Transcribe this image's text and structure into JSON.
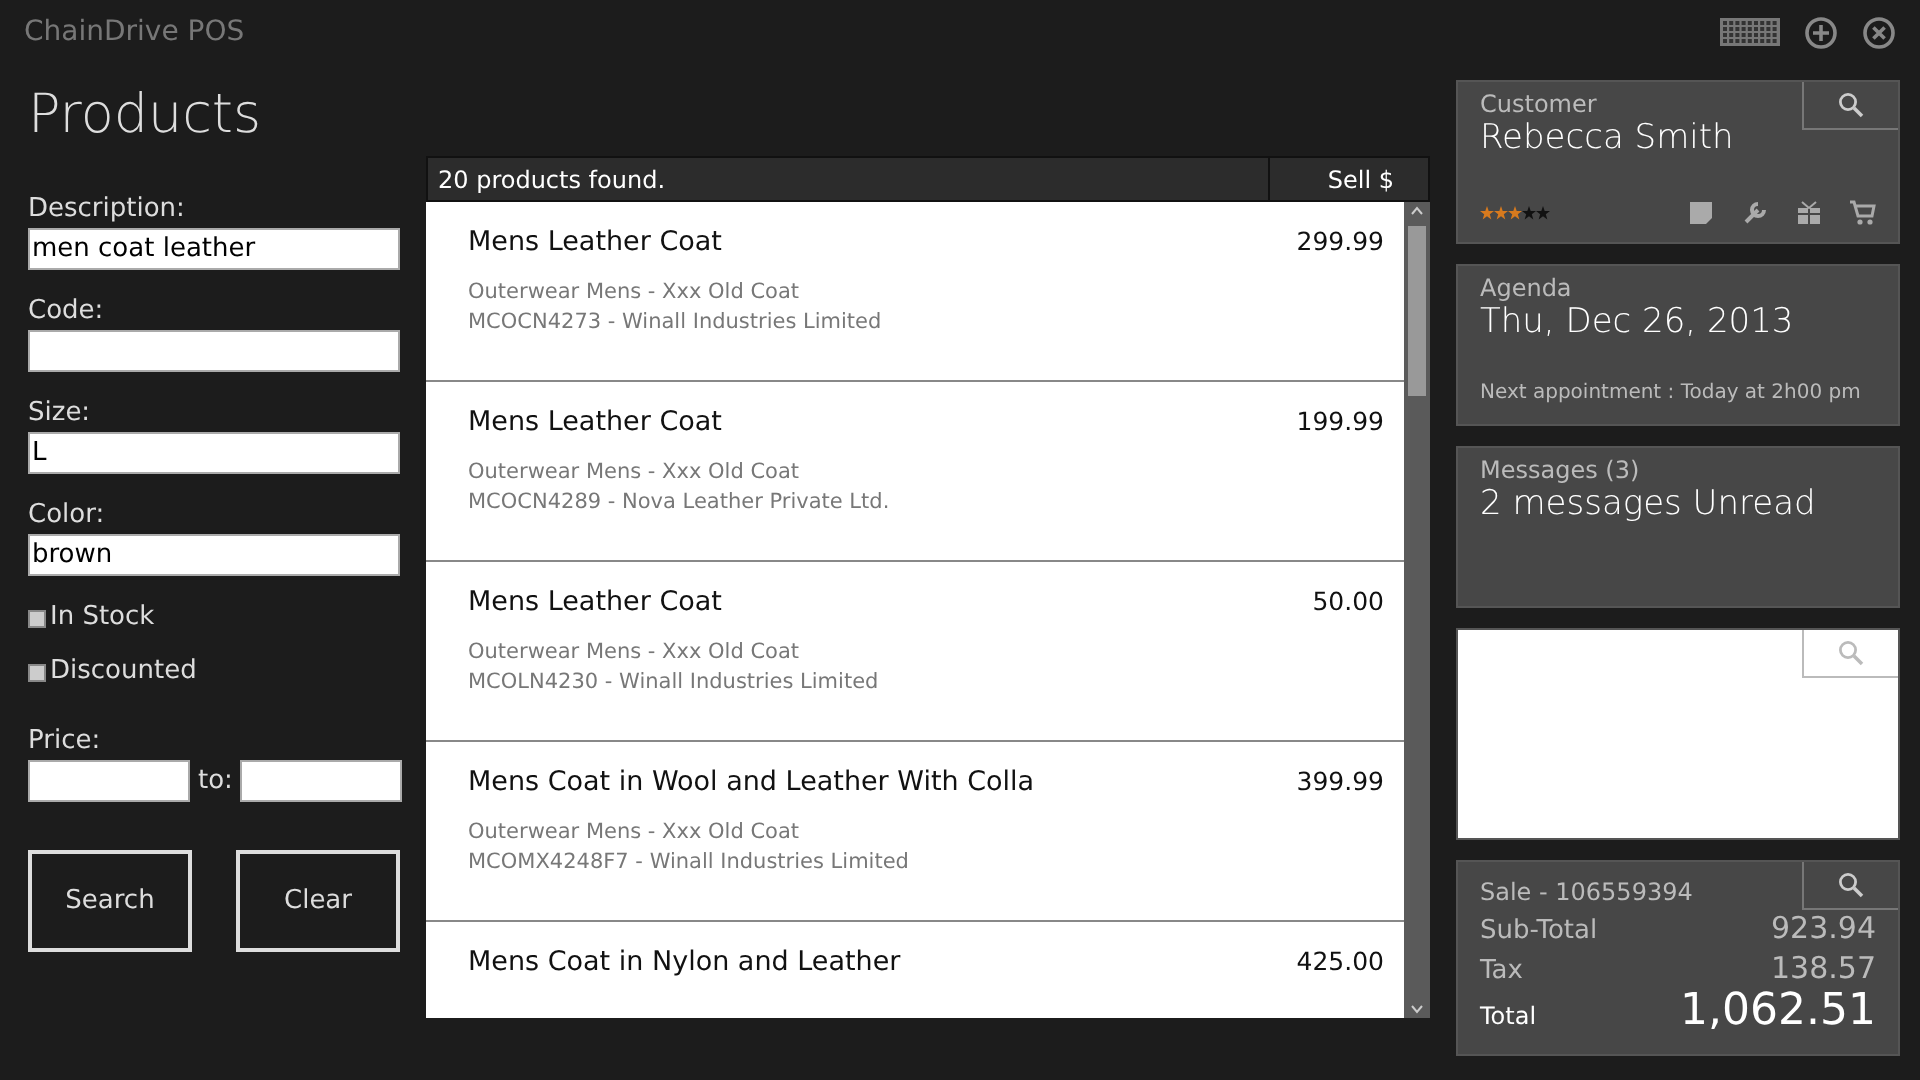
{
  "app_title": "ChainDrive POS",
  "page_title": "Products",
  "filters": {
    "fields": [
      {
        "label": "Description:",
        "value": "men coat leather"
      },
      {
        "label": "Code:"
      },
      {
        "label": "Size:",
        "value": "L"
      },
      {
        "label": "Color:",
        "value": "brown"
      }
    ],
    "checkboxes": [
      {
        "label": "In Stock",
        "checked": false
      },
      {
        "label": "Discounted",
        "checked": false
      }
    ],
    "price_label": "Price:",
    "price_to": "to:",
    "buttons": [
      "Search",
      "Clear"
    ]
  },
  "results": {
    "summary": "20 products found.",
    "price_column": "Sell $",
    "rows": [
      {
        "name": "Mens Leather Coat",
        "price": "299.99",
        "category": "Outerwear Mens - Xxx Old Coat",
        "code_vendor": "MCOCN4273 - Winall Industries Limited"
      },
      {
        "name": "Mens Leather Coat",
        "price": "199.99",
        "category": "Outerwear Mens - Xxx Old Coat",
        "code_vendor": "MCOCN4289 - Nova Leather Private Ltd."
      },
      {
        "name": "Mens Leather Coat",
        "price": "50.00",
        "category": "Outerwear Mens - Xxx Old Coat",
        "code_vendor": "MCOLN4230 - Winall Industries Limited"
      },
      {
        "name": "Mens Coat in Wool and Leather With Colla",
        "price": "399.99",
        "category": "Outerwear Mens - Xxx Old Coat",
        "code_vendor": "MCOMX4248F7 - Winall Industries Limited"
      },
      {
        "name": "Mens Coat in Nylon and Leather",
        "price": "425.00"
      }
    ]
  },
  "customer": {
    "label": "Customer",
    "name": "Rebecca Smith",
    "stars": 3
  },
  "agenda": {
    "label": "Agenda",
    "date": "Thu, Dec 26, 2013",
    "next": "Next appointment : Today at 2h00 pm"
  },
  "messages": {
    "label": "Messages (3)",
    "summary": "2 messages Unread"
  },
  "sale": {
    "label": "Sale - 106559394",
    "lines": [
      {
        "label": "Sub-Total",
        "value": "923.94",
        "kind": "normal"
      },
      {
        "label": "Tax",
        "value": "138.57",
        "kind": "normal"
      },
      {
        "label": "Total",
        "value": "1,062.51",
        "kind": "total"
      }
    ]
  }
}
